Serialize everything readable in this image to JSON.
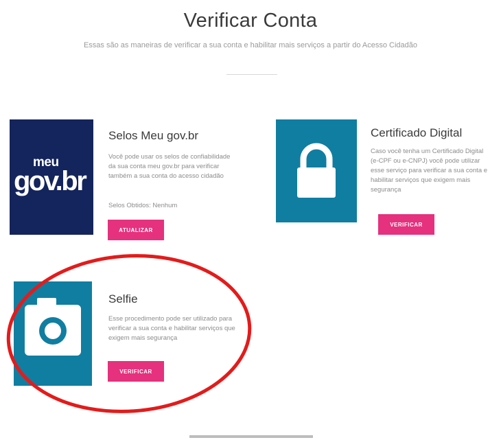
{
  "header": {
    "title": "Verificar Conta",
    "subtitle": "Essas são as maneiras de verificar a sua conta e habilitar mais serviços a partir do Acesso Cidadão"
  },
  "cards": [
    {
      "title": "Selos Meu gov.br",
      "description": "Você pode usar os selos de confiabilidade da sua conta meu gov.br para verificar também a sua conta do acesso cidadão",
      "extra": "Selos Obtidos: Nenhum",
      "button_label": "ATUALIZAR",
      "logo_small": "meu",
      "logo_large": "gov.br",
      "color": "#14245c"
    },
    {
      "title": "Certificado Digital",
      "description": "Caso você tenha um Certificado Digital (e-CPF ou e-CNPJ) você pode utilizar esse serviço para verificar a sua conta e habilitar serviços que exigem mais segurança",
      "button_label": "VERIFICAR",
      "icon": "lock-icon",
      "color": "#107ea1"
    },
    {
      "title": "Selfie",
      "description": "Esse procedimento pode ser utilizado para verificar a sua conta e habilitar serviços que exigem mais segurança",
      "button_label": "VERIFICAR",
      "icon": "camera-icon",
      "color": "#107ea1"
    }
  ],
  "colors": {
    "accent_button": "#e5317e",
    "annotation": "#e41b1b"
  }
}
